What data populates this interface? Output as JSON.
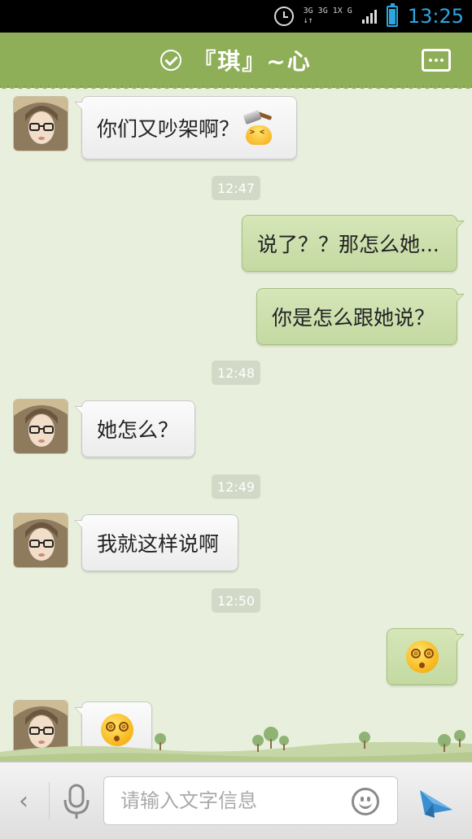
{
  "status_bar": {
    "network_top": "3G 3G 1X G",
    "network_bottom": "↓↑",
    "time": "13:25",
    "battery_level": 0.88
  },
  "header": {
    "title": "『琪』~心"
  },
  "messages": [
    {
      "side": "in",
      "text": "你们又吵架啊？",
      "emoji": "hammer-emoji"
    },
    {
      "time": "12:47"
    },
    {
      "side": "out",
      "text": "说了？？那怎么她..."
    },
    {
      "side": "out",
      "text": "你是怎么跟她说？"
    },
    {
      "time": "12:48"
    },
    {
      "side": "in",
      "text": "她怎么？"
    },
    {
      "time": "12:49"
    },
    {
      "side": "in",
      "text": "我就这样说啊"
    },
    {
      "time": "12:50"
    },
    {
      "side": "out",
      "emoji": "dizzy-emoji"
    },
    {
      "side": "in",
      "emoji": "dizzy-emoji"
    }
  ],
  "input_bar": {
    "placeholder": "请输入文字信息",
    "back_icon": "chevron-left-icon",
    "mic_icon": "microphone-icon",
    "emoji_icon": "smiley-icon",
    "send_icon": "send-icon"
  },
  "colors": {
    "header_green": "#8fae58",
    "chat_background": "#e8f0dd",
    "outgoing_bubble": "#c9ddA8",
    "time_accent": "#2ca6e0"
  }
}
